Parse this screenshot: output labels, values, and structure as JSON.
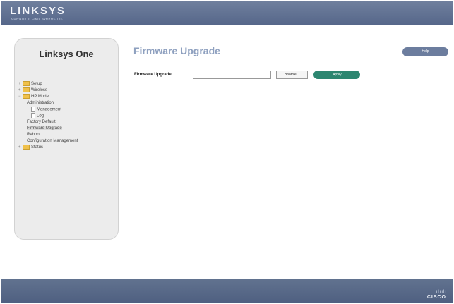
{
  "header": {
    "logo": "LINKSYS",
    "logo_sub": "A Division of Cisco Systems, Inc."
  },
  "sidebar": {
    "title": "Linksys One",
    "items": [
      {
        "label": "Setup",
        "level": 0,
        "type": "folder"
      },
      {
        "label": "Wireless",
        "level": 0,
        "type": "folder"
      },
      {
        "label": "HP Mode",
        "level": 0,
        "type": "folder"
      },
      {
        "label": "Administration",
        "level": 1,
        "type": "text"
      },
      {
        "label": "Management",
        "level": 2,
        "type": "doc"
      },
      {
        "label": "Log",
        "level": 2,
        "type": "doc"
      },
      {
        "label": "Factory Default",
        "level": 1,
        "type": "text"
      },
      {
        "label": "Firmware Upgrade",
        "level": 1,
        "type": "text",
        "selected": true
      },
      {
        "label": "Reboot",
        "level": 1,
        "type": "text"
      },
      {
        "label": "Configuration Management",
        "level": 1,
        "type": "text"
      },
      {
        "label": "Status",
        "level": 0,
        "type": "folder"
      }
    ]
  },
  "main": {
    "title": "Firmware Upgrade",
    "help_label": "Help",
    "form": {
      "label": "Firmware Upgrade",
      "file_value": "",
      "browse_label": "Browse...",
      "apply_label": "Apply"
    }
  },
  "footer": {
    "brand_mark": "ılıılı",
    "brand": "CISCO"
  }
}
